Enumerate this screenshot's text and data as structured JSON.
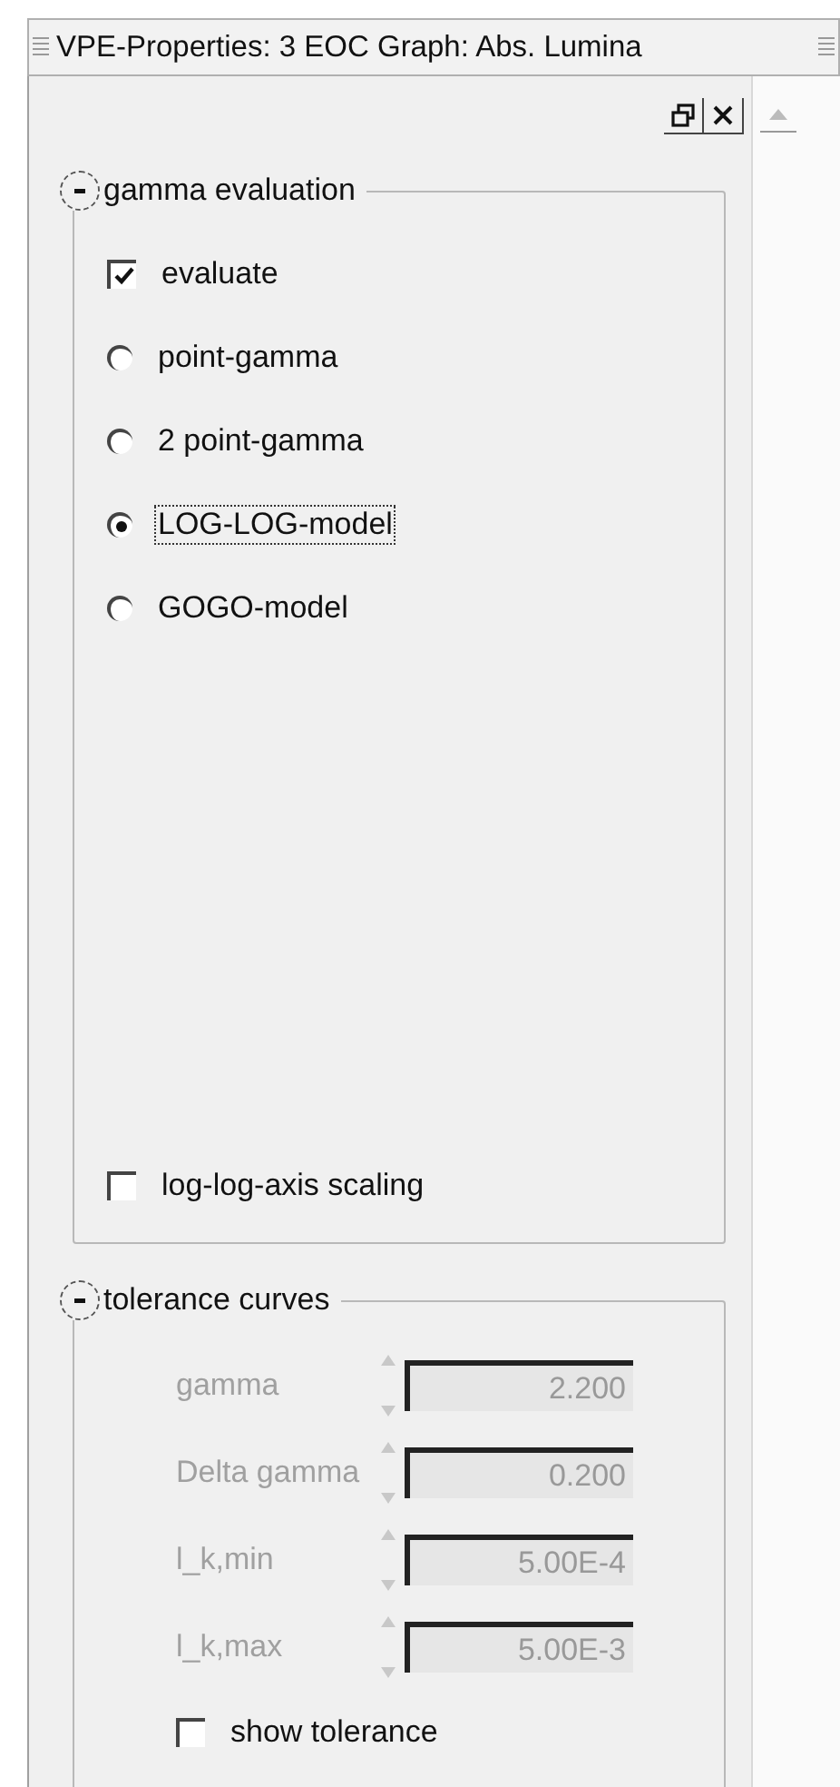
{
  "window": {
    "title": "VPE-Properties: 3 EOC Graph: Abs. Lumina"
  },
  "groups": [
    {
      "title": "gamma evaluation",
      "expanded": true,
      "items": [
        {
          "kind": "checkbox",
          "label": "evaluate",
          "checked": true,
          "disabled": false
        },
        {
          "kind": "radio",
          "label": "point-gamma",
          "selected": false,
          "focused": false
        },
        {
          "kind": "radio",
          "label": "2 point-gamma",
          "selected": false,
          "focused": false
        },
        {
          "kind": "radio",
          "label": "LOG-LOG-model",
          "selected": true,
          "focused": true
        },
        {
          "kind": "radio",
          "label": "GOGO-model",
          "selected": false,
          "focused": false
        },
        {
          "kind": "spacer"
        },
        {
          "kind": "checkbox",
          "label": "log-log-axis scaling",
          "checked": false,
          "disabled": false
        }
      ]
    },
    {
      "title": "tolerance curves",
      "expanded": true,
      "items": [
        {
          "kind": "spin",
          "label": "gamma",
          "value": "2.200",
          "disabled": true
        },
        {
          "kind": "spin",
          "label": "Delta gamma",
          "value": "0.200",
          "disabled": true
        },
        {
          "kind": "spin",
          "label": "l_k,min",
          "value": "5.00E-4",
          "disabled": true
        },
        {
          "kind": "spin",
          "label": "l_k,max",
          "value": "5.00E-3",
          "disabled": true
        },
        {
          "kind": "checkbox",
          "label": "show tolerance",
          "checked": false,
          "disabled": false,
          "indent": true
        }
      ]
    }
  ]
}
